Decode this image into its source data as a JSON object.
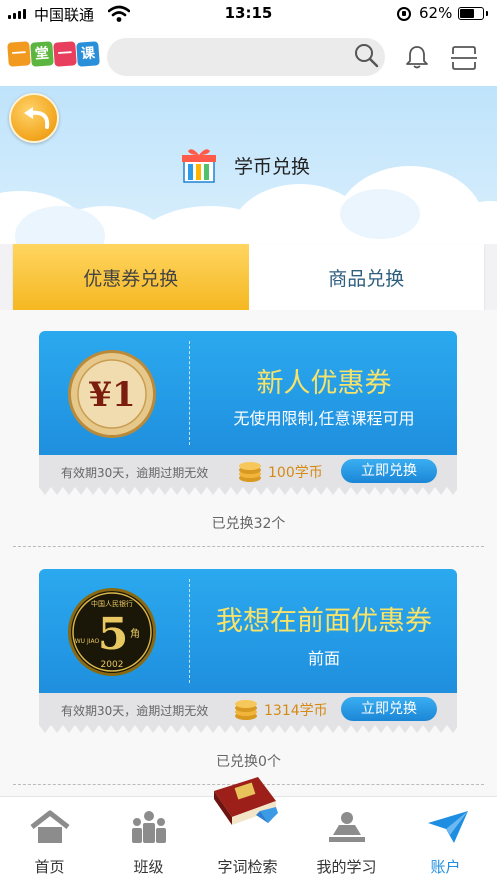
{
  "status_bar": {
    "carrier": "中国联通",
    "time": "13:15",
    "battery": "62%",
    "battery_level": 0.62
  },
  "header": {
    "logo_chars": [
      "一",
      "堂",
      "一",
      "课"
    ],
    "logo_colors": [
      "#f29a1f",
      "#5cb53e",
      "#e83f5f",
      "#2a8fd9"
    ],
    "search": {
      "placeholder": "",
      "value": ""
    },
    "icons": [
      "search-icon",
      "bell-icon",
      "scan-icon"
    ]
  },
  "banner": {
    "title": "学币兑换",
    "back_icon": "back-arrow-icon",
    "gift_icon": "gift-icon"
  },
  "tabs": [
    {
      "label": "优惠券兑换",
      "active": true
    },
    {
      "label": "商品兑换",
      "active": false
    }
  ],
  "coupons": [
    {
      "coin_label": "¥1",
      "name": "新人优惠券",
      "desc": "无使用限制,任意课程可用",
      "validity": "有效期30天，逾期过期无效",
      "price": "100学币",
      "button": "立即兑换",
      "redeemed": "已兑换32个"
    },
    {
      "coin_label": "5",
      "coin_sub": "角",
      "coin_year": "2002",
      "coin_text": "中国人民银行",
      "coin_side": "WU JIAO",
      "name": "我想在前面优惠券",
      "desc": "前面",
      "validity": "有效期30天，逾期过期无效",
      "price": "1314学币",
      "button": "立即兑换",
      "redeemed": "已兑换0个"
    }
  ],
  "bottom_nav": [
    {
      "label": "首页",
      "icon": "home-icon",
      "active": false
    },
    {
      "label": "班级",
      "icon": "class-icon",
      "active": false
    },
    {
      "label": "字词检索",
      "icon": "dictionary-book-icon",
      "active": false
    },
    {
      "label": "我的学习",
      "icon": "study-icon",
      "active": false
    },
    {
      "label": "账户",
      "icon": "account-icon",
      "active": true
    }
  ],
  "colors": {
    "accent_blue": "#1e8ee2",
    "coupon_title": "#f7e26a",
    "price": "#d58a14",
    "tab_active": "#f5b822"
  }
}
